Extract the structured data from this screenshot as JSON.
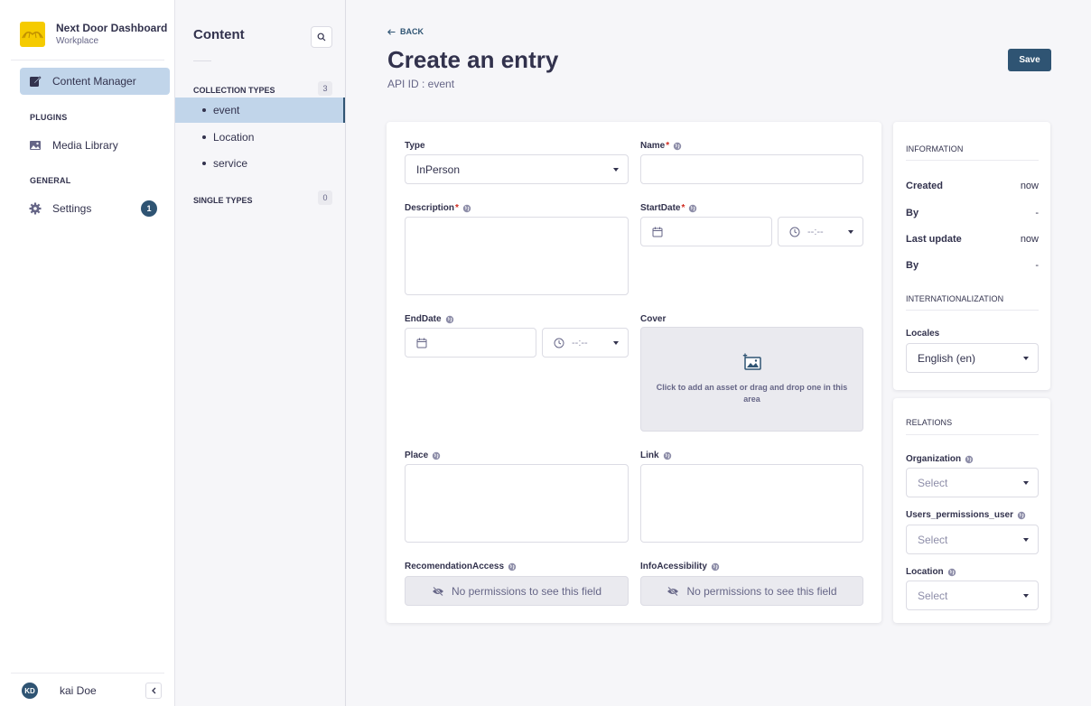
{
  "brand": {
    "name": "Next Door Dashboard",
    "subtitle": "Workplace",
    "color": "#f5cb00"
  },
  "nav": {
    "content_manager": "Content Manager",
    "plugins_section": "PLUGINS",
    "media_library": "Media Library",
    "general_section": "GENERAL",
    "settings": "Settings",
    "settings_badge": "1"
  },
  "user": {
    "initials": "KD",
    "name": "kai Doe",
    "collapse_icon": "chevron-left-icon"
  },
  "subnav": {
    "title": "Content",
    "collection_section": "COLLECTION TYPES",
    "collection_count": "3",
    "items": [
      {
        "label": "event"
      },
      {
        "label": "Location"
      },
      {
        "label": "service"
      }
    ],
    "single_section": "SINGLE TYPES",
    "single_count": "0"
  },
  "header": {
    "back": "BACK",
    "title": "Create an entry",
    "subtitle": "API ID : event",
    "save": "Save"
  },
  "form": {
    "type_label": "Type",
    "type_value": "InPerson",
    "name_label": "Name",
    "description_label": "Description",
    "startdate_label": "StartDate",
    "time_placeholder": "--:--",
    "enddate_label": "EndDate",
    "cover_label": "Cover",
    "cover_text": "Click to add an asset or drag and drop one in this area",
    "place_label": "Place",
    "link_label": "Link",
    "recomendation_label": "RecomendationAccess",
    "info_label": "InfoAcessibility",
    "no_permission": "No permissions to see this field",
    "required_mark": "*"
  },
  "information": {
    "section": "INFORMATION",
    "created_label": "Created",
    "created_value": "now",
    "by_label": "By",
    "by_value": "-",
    "updated_label": "Last update",
    "updated_value": "now",
    "by2_label": "By",
    "by2_value": "-",
    "i18n_section": "INTERNATIONALIZATION",
    "locales_label": "Locales",
    "locales_value": "English (en)"
  },
  "relations": {
    "section": "RELATIONS",
    "organization_label": "Organization",
    "users_label": "Users_permissions_user",
    "location_label": "Location",
    "select_placeholder": "Select"
  },
  "colors": {
    "primary": "#2f5473",
    "active_bg": "#c1d5ea",
    "required": "#d02b20"
  }
}
